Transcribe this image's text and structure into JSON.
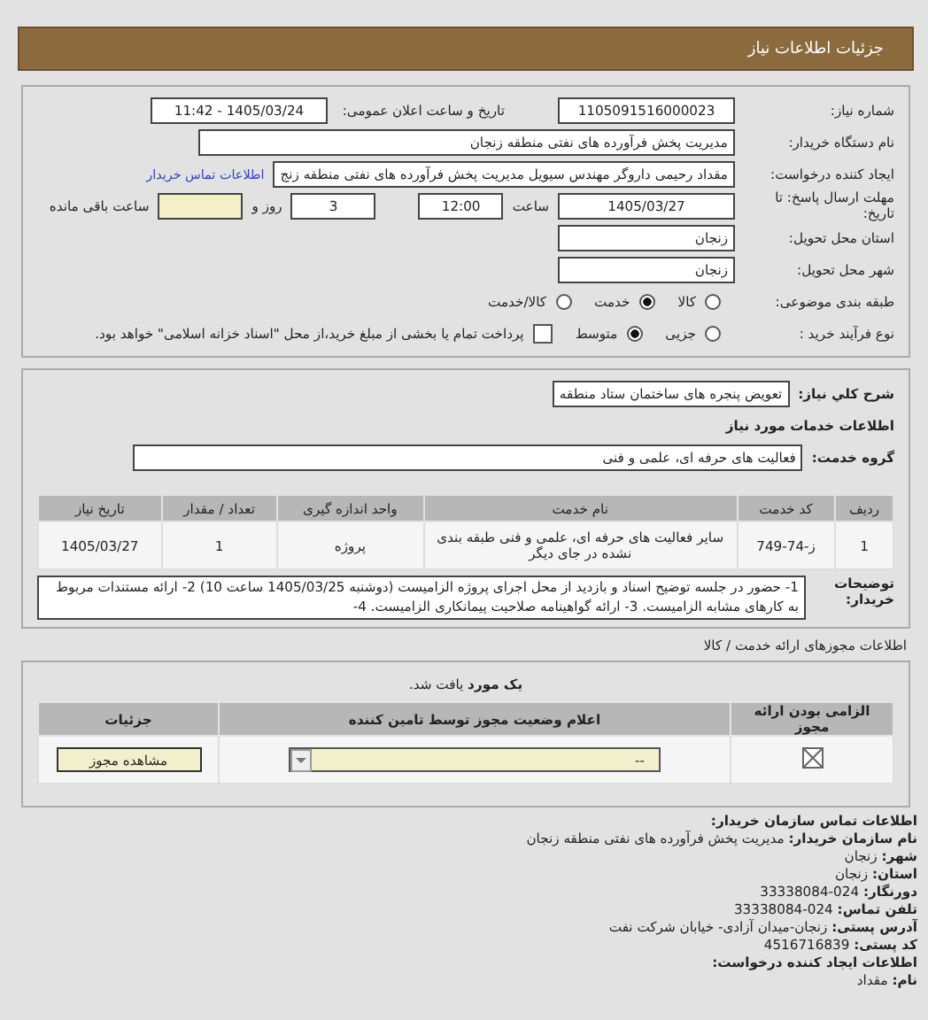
{
  "header": {
    "title": "جزئیات اطلاعات نیاز"
  },
  "need_number": {
    "label": "شماره نیاز:",
    "value": "1105091516000023"
  },
  "announce": {
    "label": "تاریخ و ساعت اعلان عمومی:",
    "value": "1405/03/24 - 11:42"
  },
  "buyer": {
    "label": "نام دستگاه خریدار:",
    "value": "مدیریت پخش فرآورده های نفتی منطقه زنجان"
  },
  "creator": {
    "label": "ایجاد کننده درخواست:",
    "value": "مقداد رحیمی داروگر مهندس سیویل مدیریت پخش فرآورده های نفتی منطقه زنج",
    "link": "اطلاعات تماس خریدار"
  },
  "deadline": {
    "label": "مهلت ارسال پاسخ: تا تاریخ:",
    "date": "1405/03/27",
    "time_label": "ساعت",
    "time": "12:00",
    "days": "3",
    "days_label": "روز و",
    "hours_label": "ساعت باقی مانده"
  },
  "province": {
    "label": "استان محل تحویل:",
    "value": "زنجان"
  },
  "city": {
    "label": "شهر محل تحویل:",
    "value": "زنجان"
  },
  "category": {
    "label": "طبقه بندی موضوعی:",
    "options": [
      {
        "label": "کالا",
        "selected": false
      },
      {
        "label": "خدمت",
        "selected": true
      },
      {
        "label": "کالا/خدمت",
        "selected": false
      }
    ]
  },
  "process": {
    "label": "نوع فرآیند خرید :",
    "options": [
      {
        "label": "جزیی",
        "selected": false
      },
      {
        "label": "متوسط",
        "selected": true
      }
    ],
    "treasury": {
      "checked": false,
      "text": "پرداخت تمام یا بخشی از مبلغ خرید،از محل \"اسناد خزانه اسلامی\" خواهد بود."
    }
  },
  "summary": {
    "label": "شرح کلي نياز:",
    "value": "تعویض پنجره های ساختمان ستاد منطقه"
  },
  "services": {
    "title": "اطلاعات خدمات مورد نیاز",
    "group_label": "گروه خدمت:",
    "group": "فعالیت های حرفه ای، علمی و فنی",
    "columns": [
      "ردیف",
      "کد خدمت",
      "نام خدمت",
      "واحد اندازه گیری",
      "تعداد / مقدار",
      "تاریخ نیاز"
    ],
    "rows": [
      [
        "1",
        "ز-74-749",
        "سایر فعالیت های حرفه ای، علمی و فنی طبقه بندی نشده در جای دیگر",
        "پروژه",
        "1",
        "1405/03/27"
      ]
    ]
  },
  "buyer_notes": {
    "label": "توضیحات خریدار:",
    "text": "1- حضور در جلسه توضیح اسناد و بازدید از محل اجرای پروژه الزامیست (دوشنبه 1405/03/25 ساعت 10) 2- ارائه مستندات مربوط به کارهای مشابه الزامیست. 3- ارائه گواهینامه صلاحیت پیمانکاری الزامیست. 4-"
  },
  "licenses": {
    "title": "اطلاعات مجوزهای ارائه خدمت / کالا",
    "found": "**یک مورد** یافت شد.",
    "columns": [
      "الزامی بودن ارائه مجوز",
      "اعلام وضعیت مجوز توسط تامین کننده",
      "جزئیات"
    ],
    "rows": [
      {
        "required": true,
        "status": "--",
        "button": "مشاهده مجوز"
      }
    ]
  },
  "contact": {
    "title": "اطلاعات تماس سازمان خریدار:",
    "lines": [
      "**نام سازمان خریدار:** مدیریت پخش فرآورده های نفتی منطقه زنجان",
      "**شهر:** زنجان",
      "**استان:** زنجان",
      "**دورنگار:** 024-33338084",
      "**تلفن تماس:** 024-33338084",
      "**آدرس پستی:** زنجان-میدان آزادی- خیابان شرکت نفت",
      "**کد پستی:** 4516716839"
    ],
    "creator_title": "اطلاعات ایجاد کننده درخواست:",
    "creator_lines": [
      "**نام:** مقداد"
    ]
  }
}
